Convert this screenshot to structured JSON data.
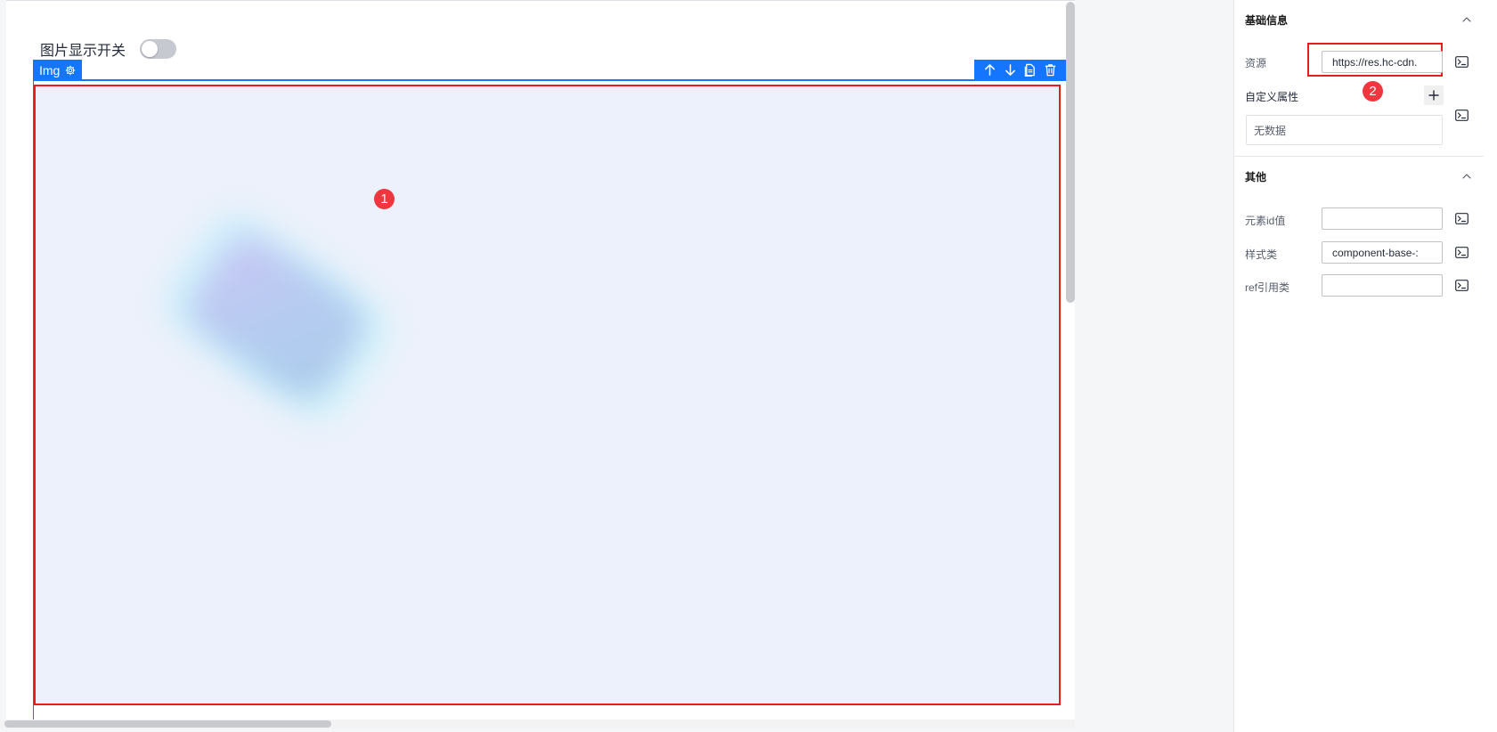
{
  "canvas": {
    "toggle_label": "图片显示开关",
    "toggle_on": false,
    "component_tag": "Img",
    "annotations": [
      "1",
      "2"
    ]
  },
  "panel": {
    "basic": {
      "title": "基础信息",
      "resource_label": "资源",
      "resource_value": "https://res.hc-cdn.",
      "custom_attr_label": "自定义属性",
      "empty_text": "无数据"
    },
    "other": {
      "title": "其他",
      "element_id_label": "元素id值",
      "element_id_value": "",
      "style_class_label": "样式类",
      "style_class_value": "component-base-:",
      "ref_label": "ref引用类",
      "ref_value": ""
    }
  },
  "colors": {
    "accent": "#1476ff",
    "annotation_red": "#e51d1d",
    "image_bg": "#ecf1fb"
  },
  "icons": {
    "component_settings": "gear-icon",
    "move_up": "arrow-up-icon",
    "move_down": "arrow-down-icon",
    "copy": "copy-icon",
    "delete": "trash-icon",
    "collapse": "chevron-up-icon",
    "bind_variable": "terminal-icon",
    "add": "plus-icon"
  }
}
